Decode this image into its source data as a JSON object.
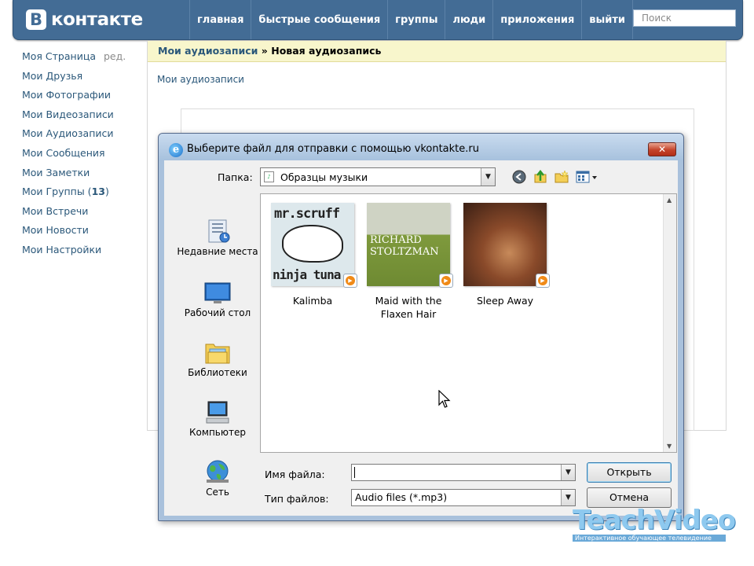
{
  "vk": {
    "logo_letter": "В",
    "logo_text": "контакте",
    "nav": [
      "главная",
      "быстрые сообщения",
      "группы",
      "люди",
      "приложения",
      "выйти"
    ],
    "search_placeholder": "Поиск",
    "sidebar": [
      {
        "label": "Моя Страница",
        "extra": "ред."
      },
      {
        "label": "Мои Друзья"
      },
      {
        "label": "Мои Фотографии"
      },
      {
        "label": "Мои Видеозаписи"
      },
      {
        "label": "Мои Аудиозаписи"
      },
      {
        "label": "Мои Сообщения"
      },
      {
        "label": "Мои Заметки"
      },
      {
        "label": "Мои Группы",
        "count": "13"
      },
      {
        "label": "Мои Встречи"
      },
      {
        "label": "Мои Новости"
      },
      {
        "label": "Мои Настройки"
      }
    ],
    "breadcrumb": {
      "link": "Мои аудиозаписи",
      "separator": "»",
      "current": "Новая аудиозапись"
    },
    "subtab": "Мои аудиозаписи"
  },
  "dialog": {
    "title": "Выберите файл для отправки с помощью vkontakte.ru",
    "close_glyph": "✕",
    "folder_label": "Папка:",
    "folder_value": "Образцы музыки",
    "places": [
      "Недавние места",
      "Рабочий стол",
      "Библиотеки",
      "Компьютер",
      "Сеть"
    ],
    "files": [
      {
        "name": "Kalimba",
        "cover_text": [
          "mr.scruff",
          "ninja tuna"
        ]
      },
      {
        "name": "Maid with the Flaxen Hair",
        "cover_text": [
          "RICHARD",
          "STOLTZMAN"
        ]
      },
      {
        "name": "Sleep Away",
        "cover_text": []
      }
    ],
    "filename_label": "Имя файла:",
    "filename_value": "",
    "filetype_label": "Тип файлов:",
    "filetype_value": "Audio files (*.mp3)",
    "open_button": "Открыть",
    "cancel_button": "Отмена"
  },
  "watermark": {
    "title": "TeachVideo",
    "subtitle": "Интерактивное обучающее телевидение"
  },
  "colors": {
    "vk_header": "#436c95",
    "vk_link": "#2b587a",
    "dialog_frame": "#a9c1dc",
    "close_red": "#c4432a"
  }
}
